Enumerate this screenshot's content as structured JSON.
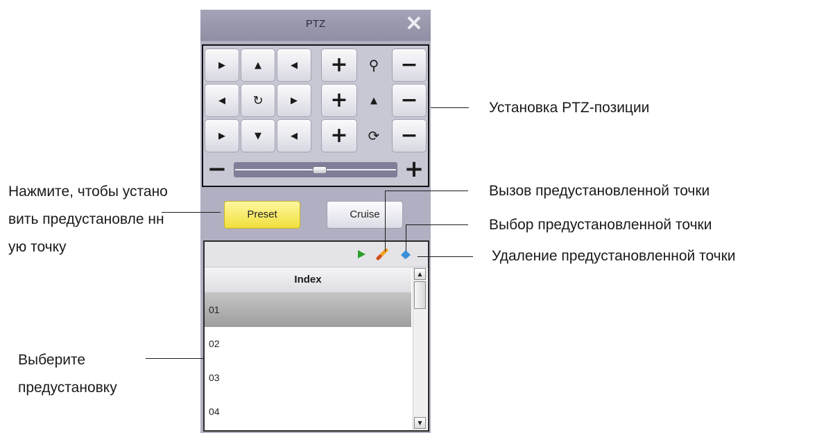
{
  "window": {
    "title": "PTZ",
    "close_glyph": "✕"
  },
  "direction_pad": [
    [
      "▶",
      "▲",
      "◀"
    ],
    [
      "◀",
      "↻",
      "▶"
    ],
    [
      "▶",
      "▼",
      "◀"
    ]
  ],
  "lens_controls": [
    {
      "plus": "+",
      "icon": "zoom-icon",
      "glyph": "⚲",
      "minus": "−"
    },
    {
      "plus": "+",
      "icon": "focus-icon",
      "glyph": "▲",
      "minus": "−"
    },
    {
      "plus": "+",
      "icon": "iris-icon",
      "glyph": "⟳",
      "minus": "−"
    }
  ],
  "speed_slider": {
    "minus": "−",
    "plus": "+",
    "level": 0.5
  },
  "modes": {
    "preset_label": "Preset",
    "cruise_label": "Cruise",
    "active": "Preset"
  },
  "preset_list": {
    "header": "Index",
    "rows": [
      "01",
      "02",
      "03",
      "04"
    ],
    "selected_index": 0,
    "toolbar_icons": [
      "call-preset-icon",
      "set-preset-icon",
      "delete-preset-icon"
    ]
  },
  "annotations": {
    "ptz_position": "Установка PTZ-позиции",
    "call_preset": "Вызов предустановленной точки",
    "choose_preset": "Выбор предустановленной точки",
    "delete_preset": "Удаление предустановленной точки",
    "click_to_set": "Нажмите, чтобы установить предустановле нную точку",
    "select_preset": "Выберите предустановку"
  },
  "colors": {
    "panel_bg": "#b0b0c2",
    "preset_button": "#f0df3c",
    "selected_row": "#a8a8a8"
  }
}
